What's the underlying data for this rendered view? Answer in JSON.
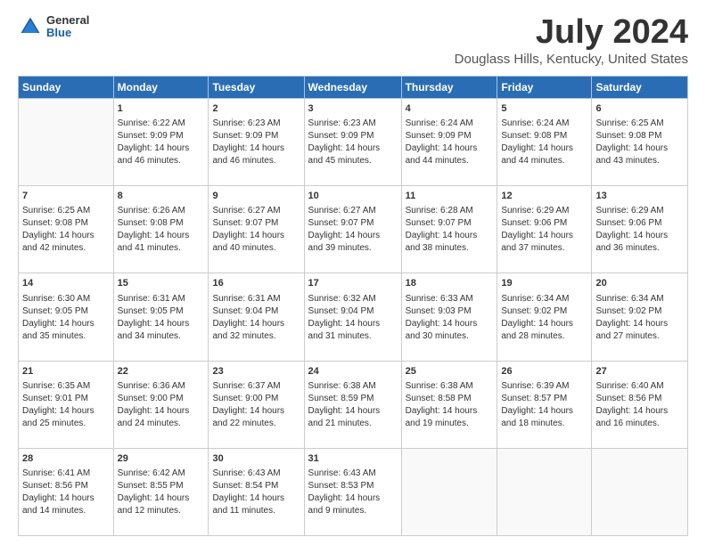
{
  "header": {
    "logo": {
      "general": "General",
      "blue": "Blue"
    },
    "title": "July 2024",
    "subtitle": "Douglass Hills, Kentucky, United States"
  },
  "calendar": {
    "days_of_week": [
      "Sunday",
      "Monday",
      "Tuesday",
      "Wednesday",
      "Thursday",
      "Friday",
      "Saturday"
    ],
    "weeks": [
      [
        {
          "day": "",
          "info": ""
        },
        {
          "day": "1",
          "info": "Sunrise: 6:22 AM\nSunset: 9:09 PM\nDaylight: 14 hours\nand 46 minutes."
        },
        {
          "day": "2",
          "info": "Sunrise: 6:23 AM\nSunset: 9:09 PM\nDaylight: 14 hours\nand 46 minutes."
        },
        {
          "day": "3",
          "info": "Sunrise: 6:23 AM\nSunset: 9:09 PM\nDaylight: 14 hours\nand 45 minutes."
        },
        {
          "day": "4",
          "info": "Sunrise: 6:24 AM\nSunset: 9:09 PM\nDaylight: 14 hours\nand 44 minutes."
        },
        {
          "day": "5",
          "info": "Sunrise: 6:24 AM\nSunset: 9:08 PM\nDaylight: 14 hours\nand 44 minutes."
        },
        {
          "day": "6",
          "info": "Sunrise: 6:25 AM\nSunset: 9:08 PM\nDaylight: 14 hours\nand 43 minutes."
        }
      ],
      [
        {
          "day": "7",
          "info": "Sunrise: 6:25 AM\nSunset: 9:08 PM\nDaylight: 14 hours\nand 42 minutes."
        },
        {
          "day": "8",
          "info": "Sunrise: 6:26 AM\nSunset: 9:08 PM\nDaylight: 14 hours\nand 41 minutes."
        },
        {
          "day": "9",
          "info": "Sunrise: 6:27 AM\nSunset: 9:07 PM\nDaylight: 14 hours\nand 40 minutes."
        },
        {
          "day": "10",
          "info": "Sunrise: 6:27 AM\nSunset: 9:07 PM\nDaylight: 14 hours\nand 39 minutes."
        },
        {
          "day": "11",
          "info": "Sunrise: 6:28 AM\nSunset: 9:07 PM\nDaylight: 14 hours\nand 38 minutes."
        },
        {
          "day": "12",
          "info": "Sunrise: 6:29 AM\nSunset: 9:06 PM\nDaylight: 14 hours\nand 37 minutes."
        },
        {
          "day": "13",
          "info": "Sunrise: 6:29 AM\nSunset: 9:06 PM\nDaylight: 14 hours\nand 36 minutes."
        }
      ],
      [
        {
          "day": "14",
          "info": "Sunrise: 6:30 AM\nSunset: 9:05 PM\nDaylight: 14 hours\nand 35 minutes."
        },
        {
          "day": "15",
          "info": "Sunrise: 6:31 AM\nSunset: 9:05 PM\nDaylight: 14 hours\nand 34 minutes."
        },
        {
          "day": "16",
          "info": "Sunrise: 6:31 AM\nSunset: 9:04 PM\nDaylight: 14 hours\nand 32 minutes."
        },
        {
          "day": "17",
          "info": "Sunrise: 6:32 AM\nSunset: 9:04 PM\nDaylight: 14 hours\nand 31 minutes."
        },
        {
          "day": "18",
          "info": "Sunrise: 6:33 AM\nSunset: 9:03 PM\nDaylight: 14 hours\nand 30 minutes."
        },
        {
          "day": "19",
          "info": "Sunrise: 6:34 AM\nSunset: 9:02 PM\nDaylight: 14 hours\nand 28 minutes."
        },
        {
          "day": "20",
          "info": "Sunrise: 6:34 AM\nSunset: 9:02 PM\nDaylight: 14 hours\nand 27 minutes."
        }
      ],
      [
        {
          "day": "21",
          "info": "Sunrise: 6:35 AM\nSunset: 9:01 PM\nDaylight: 14 hours\nand 25 minutes."
        },
        {
          "day": "22",
          "info": "Sunrise: 6:36 AM\nSunset: 9:00 PM\nDaylight: 14 hours\nand 24 minutes."
        },
        {
          "day": "23",
          "info": "Sunrise: 6:37 AM\nSunset: 9:00 PM\nDaylight: 14 hours\nand 22 minutes."
        },
        {
          "day": "24",
          "info": "Sunrise: 6:38 AM\nSunset: 8:59 PM\nDaylight: 14 hours\nand 21 minutes."
        },
        {
          "day": "25",
          "info": "Sunrise: 6:38 AM\nSunset: 8:58 PM\nDaylight: 14 hours\nand 19 minutes."
        },
        {
          "day": "26",
          "info": "Sunrise: 6:39 AM\nSunset: 8:57 PM\nDaylight: 14 hours\nand 18 minutes."
        },
        {
          "day": "27",
          "info": "Sunrise: 6:40 AM\nSunset: 8:56 PM\nDaylight: 14 hours\nand 16 minutes."
        }
      ],
      [
        {
          "day": "28",
          "info": "Sunrise: 6:41 AM\nSunset: 8:56 PM\nDaylight: 14 hours\nand 14 minutes."
        },
        {
          "day": "29",
          "info": "Sunrise: 6:42 AM\nSunset: 8:55 PM\nDaylight: 14 hours\nand 12 minutes."
        },
        {
          "day": "30",
          "info": "Sunrise: 6:43 AM\nSunset: 8:54 PM\nDaylight: 14 hours\nand 11 minutes."
        },
        {
          "day": "31",
          "info": "Sunrise: 6:43 AM\nSunset: 8:53 PM\nDaylight: 14 hours\nand 9 minutes."
        },
        {
          "day": "",
          "info": ""
        },
        {
          "day": "",
          "info": ""
        },
        {
          "day": "",
          "info": ""
        }
      ]
    ]
  }
}
